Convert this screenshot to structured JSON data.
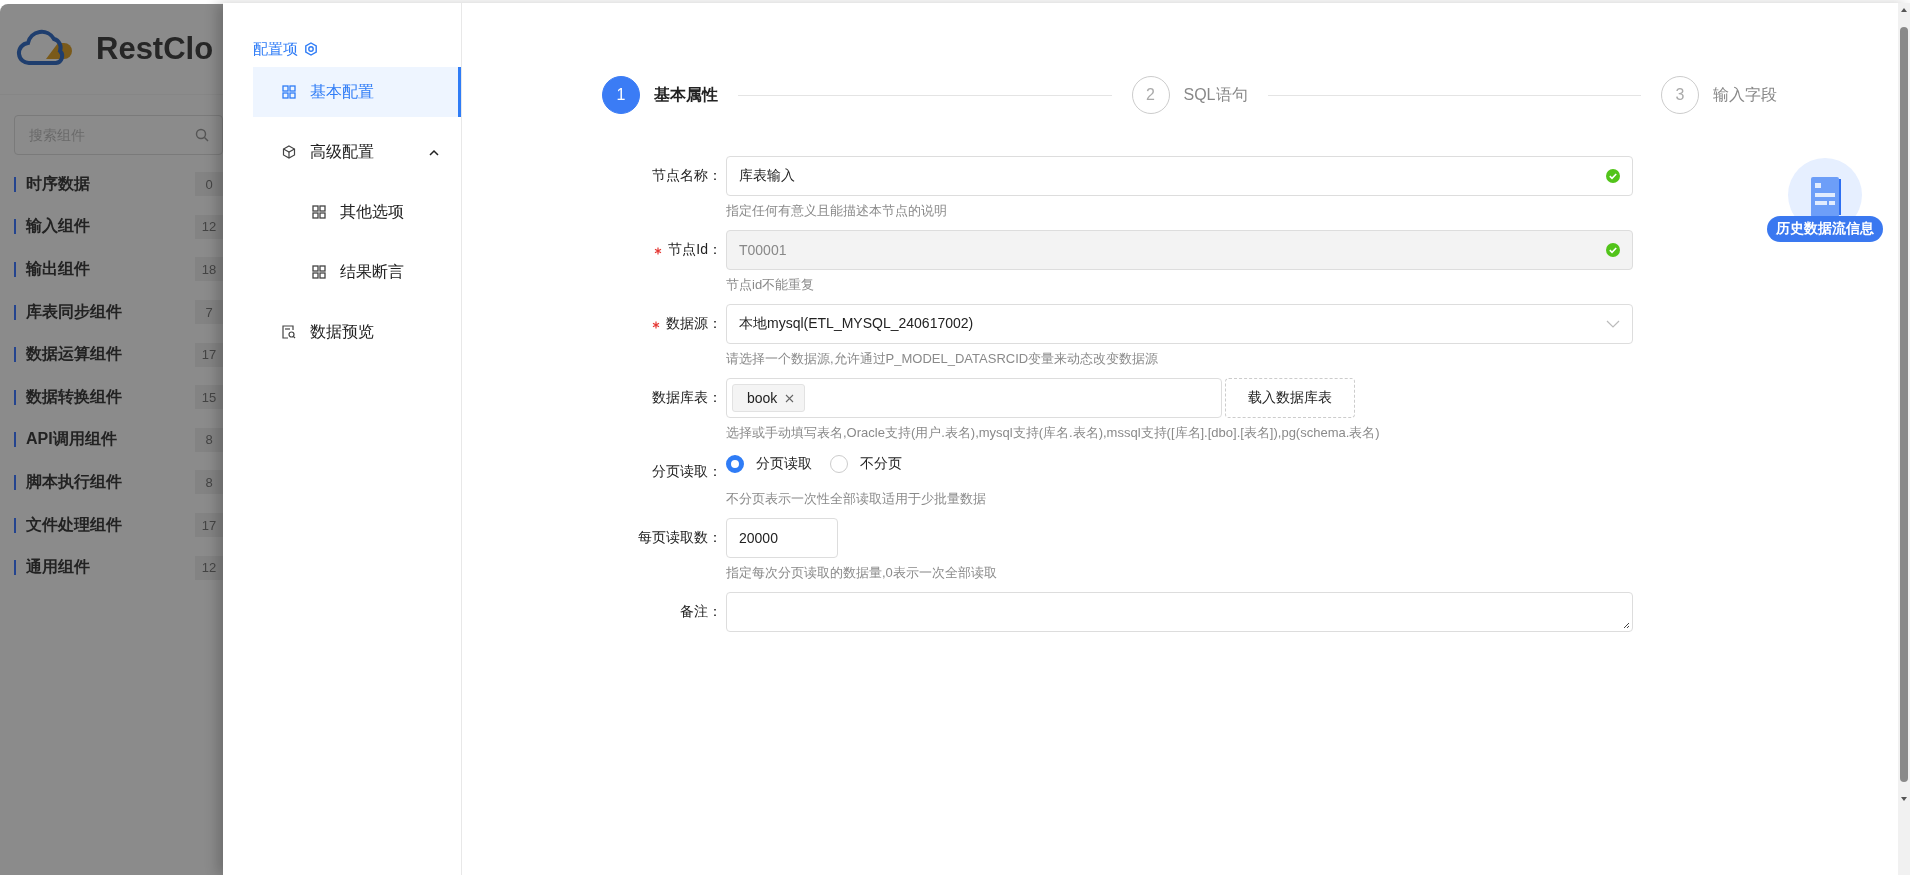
{
  "background_app": {
    "logo": "RestClo",
    "search": {
      "placeholder": "搜索组件"
    },
    "categories": [
      {
        "name": "时序数据",
        "count": "0"
      },
      {
        "name": "输入组件",
        "count": "12"
      },
      {
        "name": "输出组件",
        "count": "18"
      },
      {
        "name": "库表同步组件",
        "count": "7"
      },
      {
        "name": "数据运算组件",
        "count": "17"
      },
      {
        "name": "数据转换组件",
        "count": "15"
      },
      {
        "name": "API调用组件",
        "count": "8"
      },
      {
        "name": "脚本执行组件",
        "count": "8"
      },
      {
        "name": "文件处理组件",
        "count": "17"
      },
      {
        "name": "通用组件",
        "count": "12"
      }
    ]
  },
  "drawer": {
    "menu_title": "配置项",
    "menu": [
      {
        "label": "基本配置",
        "kind": "grid",
        "selected": true
      },
      {
        "label": "高级配置",
        "kind": "cube",
        "selected": false,
        "expanded": true,
        "children": [
          {
            "label": "其他选项",
            "kind": "grid",
            "selected": false
          },
          {
            "label": "结果断言",
            "kind": "grid",
            "selected": false
          }
        ]
      },
      {
        "label": "数据预览",
        "kind": "preview",
        "selected": false
      }
    ],
    "steps": [
      {
        "number": "1",
        "label": "基本属性",
        "selected": true
      },
      {
        "number": "2",
        "label": "SQL语句",
        "selected": false
      },
      {
        "number": "3",
        "label": "输入字段",
        "selected": false
      }
    ],
    "form": [
      {
        "kind": "text",
        "label": "节点名称：",
        "required": false,
        "value": "库表输入",
        "valid": true,
        "disabled": false,
        "hint": "指定任何有意义且能描述本节点的说明"
      },
      {
        "kind": "text",
        "label": "节点Id：",
        "required": true,
        "value": "T00001",
        "valid": true,
        "disabled": true,
        "hint": "节点id不能重复"
      },
      {
        "kind": "select",
        "label": "数据源：",
        "required": true,
        "value": "本地mysql(ETL_MYSQL_240617002)",
        "hint": "请选择一个数据源,允许通过P_MODEL_DATASRCID变量来动态改变数据源"
      },
      {
        "kind": "tags",
        "label": "数据库表：",
        "required": false,
        "tags": [
          "book"
        ],
        "button": "载入数据库表",
        "hint": "选择或手动填写表名,Oracle支持(用户.表名),mysql支持(库名.表名),mssql支持([库名].[dbo].[表名]),pg(schema.表名)"
      },
      {
        "kind": "radio",
        "label": "分页读取：",
        "required": false,
        "options": [
          {
            "label": "分页读取",
            "selected": true
          },
          {
            "label": "不分页",
            "selected": false
          }
        ],
        "hint": "不分页表示一次性全部读取适用于少批量数据"
      },
      {
        "kind": "number",
        "label": "每页读取数：",
        "required": false,
        "value": "20000",
        "hint": "指定每次分页读取的数据量,0表示一次全部读取"
      },
      {
        "kind": "textarea",
        "label": "备注：",
        "required": false
      }
    ],
    "history_badge": "历史数据流信息"
  }
}
